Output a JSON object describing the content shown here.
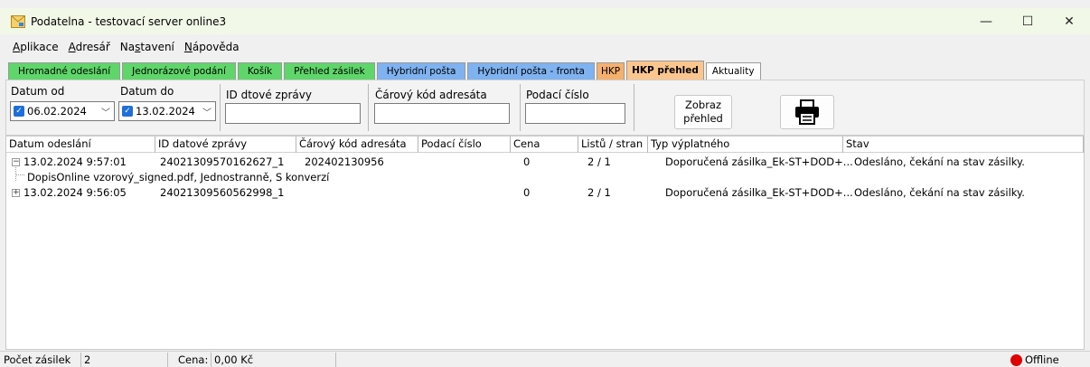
{
  "window": {
    "title": "Podatelna - testovací server online3",
    "controls": {
      "minimize": "—",
      "maximize": "☐",
      "close": "✕"
    }
  },
  "menu": [
    {
      "first": "A",
      "rest": "plikace"
    },
    {
      "first": "A",
      "rest": "dresář"
    },
    {
      "pre": "Na",
      "u": "s",
      "post": "tavení"
    },
    {
      "first": "N",
      "rest": "ápověda"
    }
  ],
  "tabs": [
    {
      "label": "Hromadné odeslání",
      "color": "green"
    },
    {
      "label": "Jednorázové podání",
      "color": "green"
    },
    {
      "label": "Košík",
      "color": "green"
    },
    {
      "label": "Přehled zásilek",
      "color": "green"
    },
    {
      "label": "Hybridní pošta",
      "color": "blue"
    },
    {
      "label": "Hybridní pošta - fronta",
      "color": "blue"
    },
    {
      "label": "HKP",
      "color": "orange"
    },
    {
      "label": "HKP přehled",
      "color": "orange",
      "active": true
    },
    {
      "label": "Aktuality",
      "color": "white"
    }
  ],
  "filter": {
    "date_from_label": "Datum od",
    "date_from_value": "06.02.2024",
    "date_to_label": "Datum do",
    "date_to_value": "13.02.2024",
    "msg_id_label": "ID dtové zprávy",
    "barcode_label": "Čárový kód adresáta",
    "post_num_label": "Podací číslo",
    "show_button": "Zobraz přehled",
    "print_icon": "printer-icon"
  },
  "table": {
    "columns": [
      "Datum odeslání",
      "ID datové zprávy",
      "Čárový kód adresáta",
      "Podací číslo",
      "Cena",
      "Listů / stran",
      "Typ výplatného",
      "Stav"
    ],
    "rows": [
      {
        "expander": "−",
        "date": "13.02.2024 9:57:01",
        "id": "24021309570162627_1",
        "barcode": "202402130956",
        "podaci": "",
        "cena": "0",
        "listu": "2 / 1",
        "typ": "Doporučená zásilka_Ek-ST+DOD+...",
        "stav": "Odesláno, čekání na stav zásilky."
      },
      {
        "child": "DopisOnline vzorový_signed.pdf, Jednostranně, S konverzí"
      },
      {
        "expander": "+",
        "date": "13.02.2024 9:56:05",
        "id": "24021309560562998_1",
        "barcode": "",
        "podaci": "",
        "cena": "0",
        "listu": "2 / 1",
        "typ": "Doporučená zásilka_Ek-ST+DOD+...",
        "stav": "Odesláno, čekání na stav zásilky."
      }
    ]
  },
  "status": {
    "count_label": "Počet zásilek",
    "count_value": "2",
    "price_label": "Cena:",
    "price_value": "0,00 Kč",
    "connection": "Offline",
    "connection_color": "#e00000"
  },
  "colors": {
    "tab_green": "#5fd66a",
    "tab_blue": "#7fb2f0",
    "tab_orange": "#f5b06c",
    "title_bg": "#f2f8e7"
  }
}
